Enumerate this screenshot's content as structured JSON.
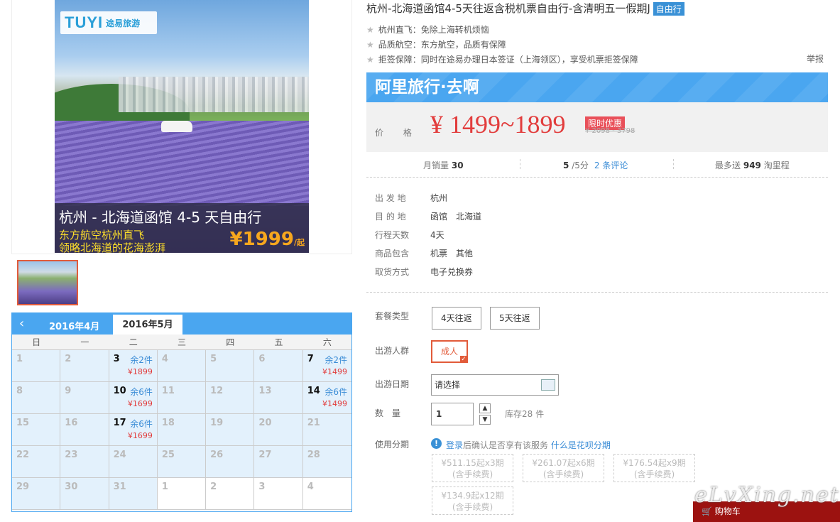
{
  "hero": {
    "logo_text": "TUYI",
    "logo_cn": "途易旅游",
    "caption_title": "杭州 - 北海道函馆 4-5 天自由行",
    "caption_sub1": "东方航空杭州直飞",
    "caption_sub2": "领略北海道的花海澎湃",
    "caption_price": "¥1999",
    "caption_price_suffix": "/起"
  },
  "calendar": {
    "month_prev": "2016年4月",
    "month_current": "2016年5月",
    "weekdays": [
      "日",
      "一",
      "二",
      "三",
      "四",
      "五",
      "六"
    ],
    "cells": [
      {
        "day": "1",
        "on": false
      },
      {
        "day": "2",
        "on": false
      },
      {
        "day": "3",
        "on": true,
        "stock": "余2件",
        "price": "¥1899"
      },
      {
        "day": "4",
        "on": false
      },
      {
        "day": "5",
        "on": false
      },
      {
        "day": "6",
        "on": false
      },
      {
        "day": "7",
        "on": true,
        "stock": "余2件",
        "price": "¥1499"
      },
      {
        "day": "8",
        "on": false
      },
      {
        "day": "9",
        "on": false
      },
      {
        "day": "10",
        "on": true,
        "stock": "余6件",
        "price": "¥1699"
      },
      {
        "day": "11",
        "on": false
      },
      {
        "day": "12",
        "on": false
      },
      {
        "day": "13",
        "on": false
      },
      {
        "day": "14",
        "on": true,
        "stock": "余6件",
        "price": "¥1499"
      },
      {
        "day": "15",
        "on": false
      },
      {
        "day": "16",
        "on": false
      },
      {
        "day": "17",
        "on": true,
        "stock": "余6件",
        "price": "¥1699"
      },
      {
        "day": "18",
        "on": false
      },
      {
        "day": "19",
        "on": false
      },
      {
        "day": "20",
        "on": false
      },
      {
        "day": "21",
        "on": false
      },
      {
        "day": "22",
        "on": false
      },
      {
        "day": "23",
        "on": false
      },
      {
        "day": "24",
        "on": false
      },
      {
        "day": "25",
        "on": false
      },
      {
        "day": "26",
        "on": false
      },
      {
        "day": "27",
        "on": false
      },
      {
        "day": "28",
        "on": false
      },
      {
        "day": "29",
        "on": false
      },
      {
        "day": "30",
        "on": false
      },
      {
        "day": "31",
        "on": false
      },
      {
        "day": "1",
        "on": false,
        "out": true
      },
      {
        "day": "2",
        "on": false,
        "out": true
      },
      {
        "day": "3",
        "on": false,
        "out": true
      },
      {
        "day": "4",
        "on": false,
        "out": true
      }
    ]
  },
  "product": {
    "title": "杭州-北海道函馆4-5天往返含税机票自由行-含清明五一假期J",
    "tag": "自由行",
    "features": [
      "杭州直飞：免除上海转机烦恼",
      "品质航空：东方航空，品质有保障",
      "拒签保障：同时在途易办理日本签证（上海领区），享受机票拒签保障"
    ],
    "report": "举报"
  },
  "price": {
    "banner": "阿里旅行·去啊",
    "label": "价 格",
    "currency": "¥",
    "range": "1499~1899",
    "promo": "限时优惠",
    "original": "¥ 2098 - 3798"
  },
  "stats": {
    "sales_label": "月销量",
    "sales_value": "30",
    "score_value": "5",
    "score_suffix": "/5分",
    "reviews_link": "2 条评论",
    "points_prefix": "最多送",
    "points_value": "949",
    "points_suffix": "淘里程"
  },
  "details": [
    {
      "k": "出 发 地",
      "v": "杭州"
    },
    {
      "k": "目 的 地",
      "v": "函馆　北海道"
    },
    {
      "k": "行程天数",
      "v": "4天"
    },
    {
      "k": "商品包含",
      "v": "机票　其他"
    },
    {
      "k": "取货方式",
      "v": "电子兑换券"
    }
  ],
  "form": {
    "package_label": "套餐类型",
    "package_options": [
      "4天往返",
      "5天往返"
    ],
    "people_label": "出游人群",
    "people_option": "成人",
    "date_label": "出游日期",
    "date_value": "请选择",
    "qty_label": "数　量",
    "qty_value": "1",
    "stock_text": "库存28 件",
    "installment_label": "使用分期",
    "installment_link1": "登录",
    "installment_text": "后确认是否享有该服务",
    "installment_link2": "什么是花呗分期",
    "plans": [
      {
        "amount": "¥511.15起x3期",
        "fee": "(含手续费)"
      },
      {
        "amount": "¥261.07起x6期",
        "fee": "(含手续费)"
      },
      {
        "amount": "¥176.54起x9期",
        "fee": "(含手续费)"
      },
      {
        "amount": "¥134.9起x12期",
        "fee": "(含手续费)"
      }
    ]
  },
  "cart": {
    "label": "购物车"
  },
  "watermark": "eLvXing.net",
  "colors": {
    "accent": "#4aa6f0",
    "price_red": "#e23d3d",
    "link": "#3a8cd6",
    "cart": "#9c1210"
  }
}
